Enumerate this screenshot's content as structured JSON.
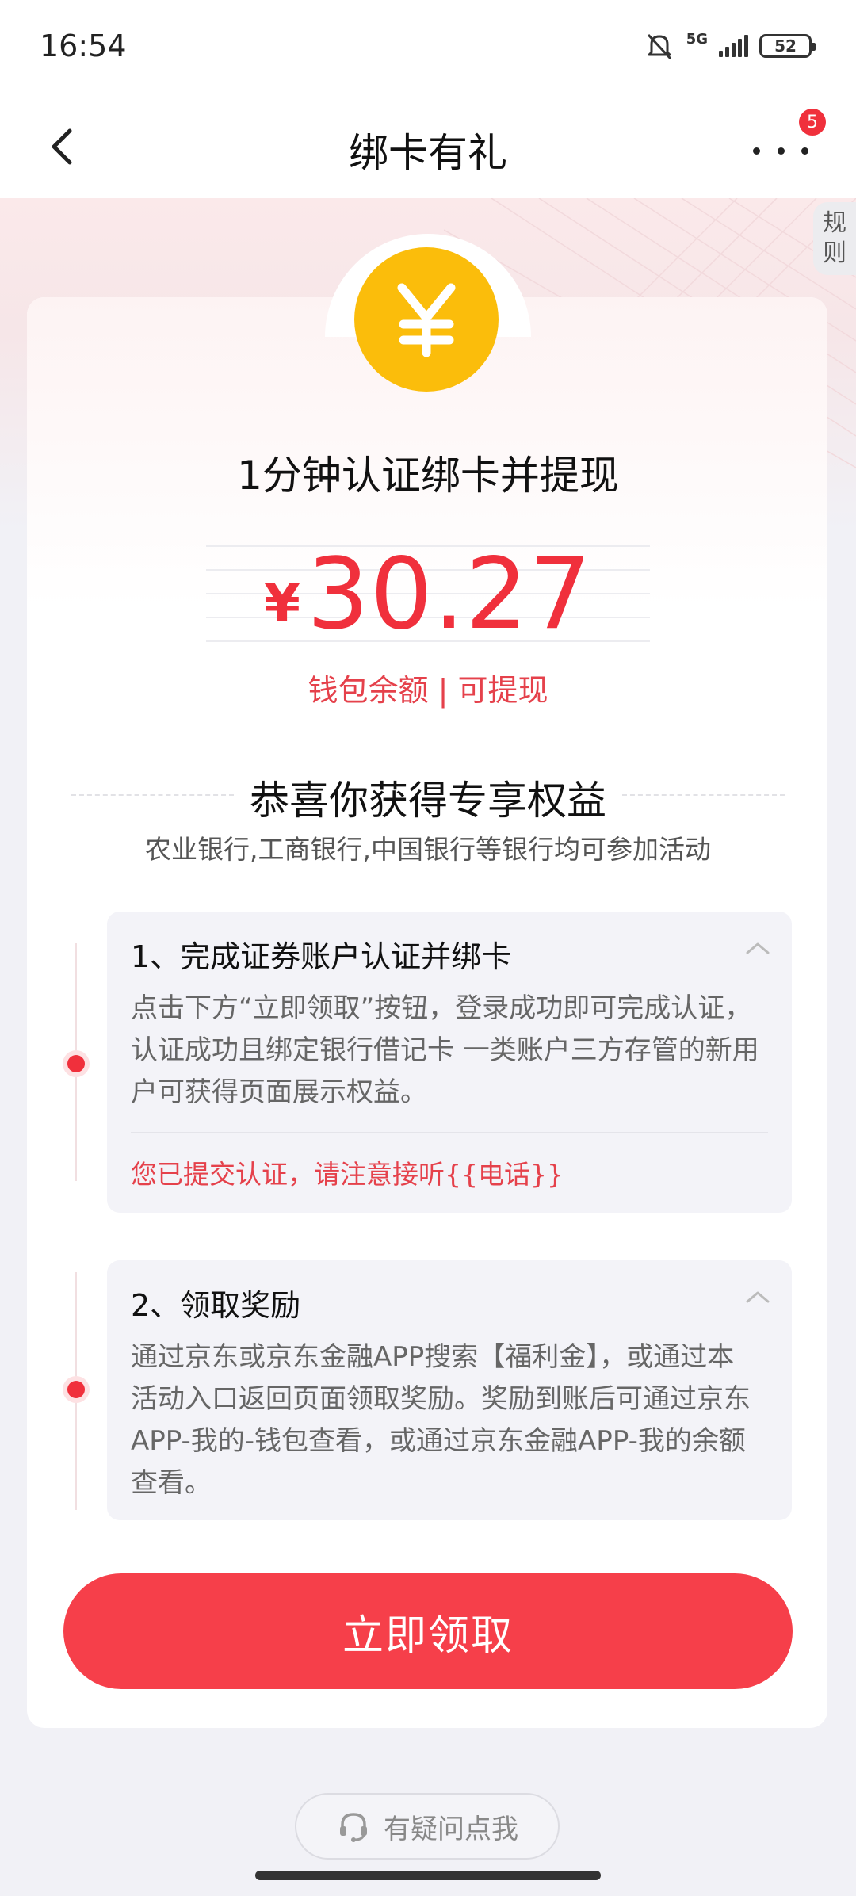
{
  "status_bar": {
    "time": "16:54",
    "network": "5G",
    "battery": "52"
  },
  "nav": {
    "title": "绑卡有礼",
    "more_badge": "5"
  },
  "rules_tab": {
    "line1": "规",
    "line2": "则"
  },
  "hero": {
    "coin_symbol": "¥",
    "headline": "1分钟认证绑卡并提现",
    "currency": "¥",
    "amount": "30.27",
    "balance_label": "钱包余额 | 可提现"
  },
  "benefits": {
    "title": "恭喜你获得专享权益",
    "subtitle": "农业银行,工商银行,中国银行等银行均可参加活动"
  },
  "steps": [
    {
      "title": "1、完成证券账户认证并绑卡",
      "lines": [
        "点击下方“立即领取”按钮，登录成功即可完成认证，",
        "认证成功且绑定银行借记卡 一类账户三方存管的新用",
        "户可获得页面展示权益。"
      ],
      "note": "您已提交认证，请注意接听{{电话}}"
    },
    {
      "title": "2、领取奖励",
      "lines": [
        "通过京东或京东金融APP搜索【福利金】，或通过本",
        "活动入口返回页面领取奖励。奖励到账后可通过京东",
        "APP-我的-钱包查看，或通过京东金融APP-我的余额",
        "查看。"
      ]
    }
  ],
  "cta": {
    "label": "立即领取"
  },
  "help": {
    "label": "有疑问点我"
  },
  "colors": {
    "accent": "#f63f4a",
    "coin": "#fbbd0b",
    "note": "#e5414b"
  }
}
